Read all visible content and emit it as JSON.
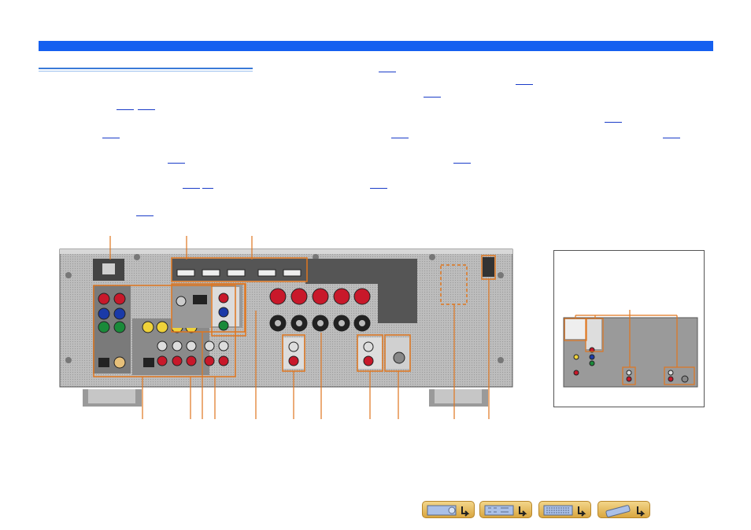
{
  "page": {
    "header_bar_color": "#1560f0",
    "accent_orange": "#e0761e",
    "link_color": "#1a3cc8"
  },
  "page_refs": [],
  "navigation": [
    {
      "icon": "front-panel-icon"
    },
    {
      "icon": "rear-panel-icon"
    },
    {
      "icon": "display-icon"
    },
    {
      "icon": "remote-control-icon"
    }
  ]
}
